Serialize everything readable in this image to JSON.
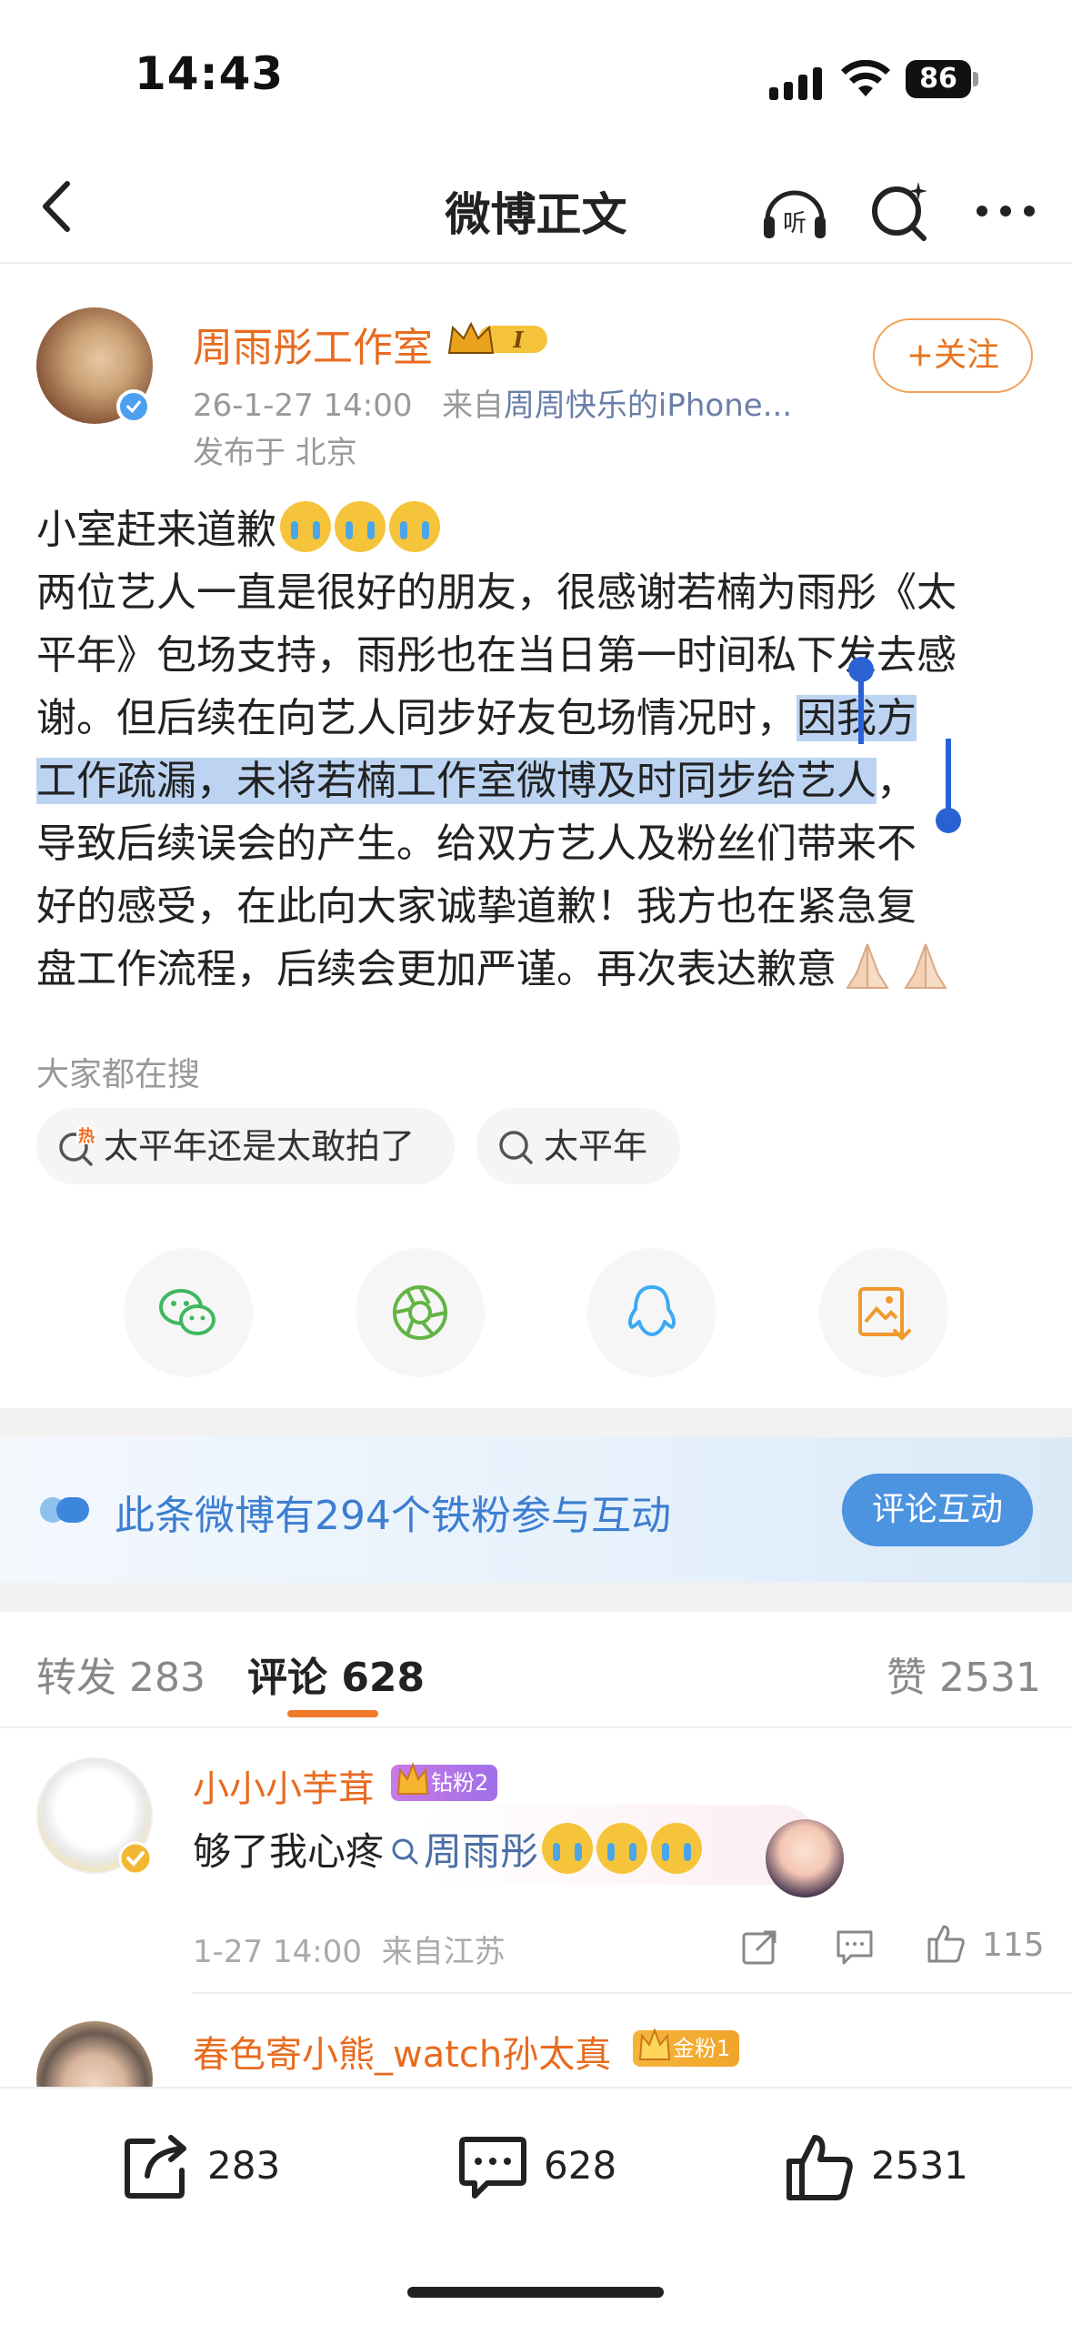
{
  "status_bar": {
    "time": "14:43",
    "battery": "86"
  },
  "nav": {
    "title": "微博正文",
    "listen_label": "听"
  },
  "post": {
    "author": "周雨彤工作室",
    "vip_level": "I",
    "date": "26-1-27 14:00",
    "source_prefix": "来自",
    "source": "周周快乐的iPhone...",
    "location": "发布于 北京",
    "follow_label": "+关注",
    "lines": [
      "小室赶来道歉",
      "两位艺人一直是很好的朋友，很感谢若楠为雨彤《太",
      "平年》包场支持，雨彤也在当日第一时间私下发去感",
      "谢。但后续在向艺人同步好友包场情况时，",
      "因我方",
      "工作疏漏，未将若楠工作室微博及时同步给艺人",
      "，",
      "导致后续误会的产生。给双方艺人及粉丝们带来不",
      "好的感受，在此向大家诚挚道歉！我方也在紧急复",
      "盘工作流程，后续会更加严谨。再次表达歉意"
    ]
  },
  "search": {
    "header": "大家都在搜",
    "chips": [
      "太平年还是太敢拍了",
      "太平年"
    ],
    "hot_mark": "热"
  },
  "fans_banner": {
    "text": "此条微博有294个铁粉参与互动",
    "button": "评论互动"
  },
  "tabs": {
    "repost": "转发 283",
    "comment": "评论 628",
    "like": "赞 2531"
  },
  "comments": [
    {
      "name": "小小小芋茸",
      "badge": "钻粉2",
      "text_prefix": "够了我心疼",
      "topic": "周雨彤",
      "time": "1-27 14:00",
      "location": "来自江苏",
      "likes": "115"
    },
    {
      "name": "春色寄小熊_watch孙太真",
      "badge": "金粉1"
    }
  ],
  "bottom_bar": {
    "repost": "283",
    "comment": "628",
    "like": "2531"
  },
  "colors": {
    "accent_orange": "#e86b1f",
    "link_blue": "#4a6fa5",
    "selection": "#bcd4f2"
  }
}
